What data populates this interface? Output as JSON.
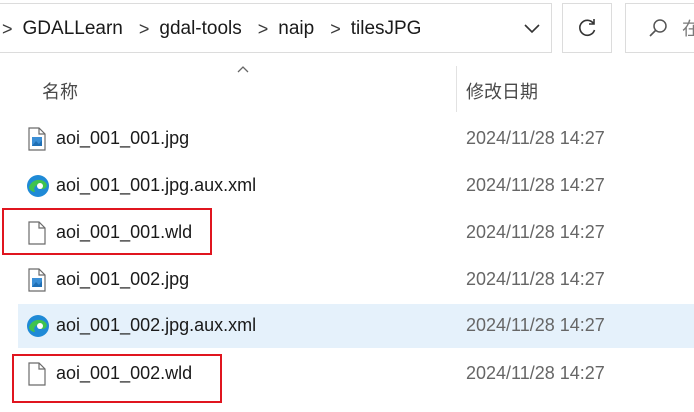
{
  "addressbar": {
    "breadcrumbs": [
      "GDALLearn",
      "gdal-tools",
      "naip",
      "tilesJPG"
    ],
    "separator": ">"
  },
  "search": {
    "placeholder": "在"
  },
  "columns": {
    "name": "名称",
    "date_modified": "修改日期"
  },
  "files": [
    {
      "name": "aoi_001_001.jpg",
      "date": "2024/11/28 14:27",
      "icon": "jpg-file-icon",
      "highlighted": false,
      "hover": false
    },
    {
      "name": "aoi_001_001.jpg.aux.xml",
      "date": "2024/11/28 14:27",
      "icon": "edge-xml-icon",
      "highlighted": false,
      "hover": false
    },
    {
      "name": "aoi_001_001.wld",
      "date": "2024/11/28 14:27",
      "icon": "blank-file-icon",
      "highlighted": true,
      "hover": false
    },
    {
      "name": "aoi_001_002.jpg",
      "date": "2024/11/28 14:27",
      "icon": "jpg-file-icon",
      "highlighted": false,
      "hover": false
    },
    {
      "name": "aoi_001_002.jpg.aux.xml",
      "date": "2024/11/28 14:27",
      "icon": "edge-xml-icon",
      "highlighted": false,
      "hover": true
    },
    {
      "name": "aoi_001_002.wld",
      "date": "2024/11/28 14:27",
      "icon": "blank-file-icon",
      "highlighted": true,
      "hover": false
    }
  ],
  "colors": {
    "highlight": "#e0151f",
    "hover": "#e5f1fb",
    "edge_blue": "#1f8ad6",
    "edge_green": "#3fc34e"
  }
}
